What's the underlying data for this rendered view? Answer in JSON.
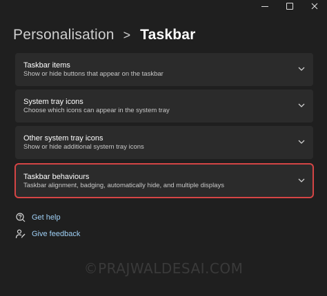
{
  "window": {
    "controls": {
      "minimize_icon": "minimize-icon",
      "maximize_icon": "maximize-icon",
      "close_icon": "close-icon"
    }
  },
  "breadcrumb": {
    "parent": "Personalisation",
    "separator": ">",
    "current": "Taskbar"
  },
  "items": [
    {
      "title": "Taskbar items",
      "subtitle": "Show or hide buttons that appear on the taskbar"
    },
    {
      "title": "System tray icons",
      "subtitle": "Choose which icons can appear in the system tray"
    },
    {
      "title": "Other system tray icons",
      "subtitle": "Show or hide additional system tray icons"
    },
    {
      "title": "Taskbar behaviours",
      "subtitle": "Taskbar alignment, badging, automatically hide, and multiple displays"
    }
  ],
  "links": {
    "help": "Get help",
    "feedback": "Give feedback"
  },
  "watermark": "©PRAJWALDESAI.COM",
  "colors": {
    "background": "#1f1f1f",
    "card": "#2b2b2b",
    "link": "#9fd0f6",
    "highlight": "#d64545"
  }
}
